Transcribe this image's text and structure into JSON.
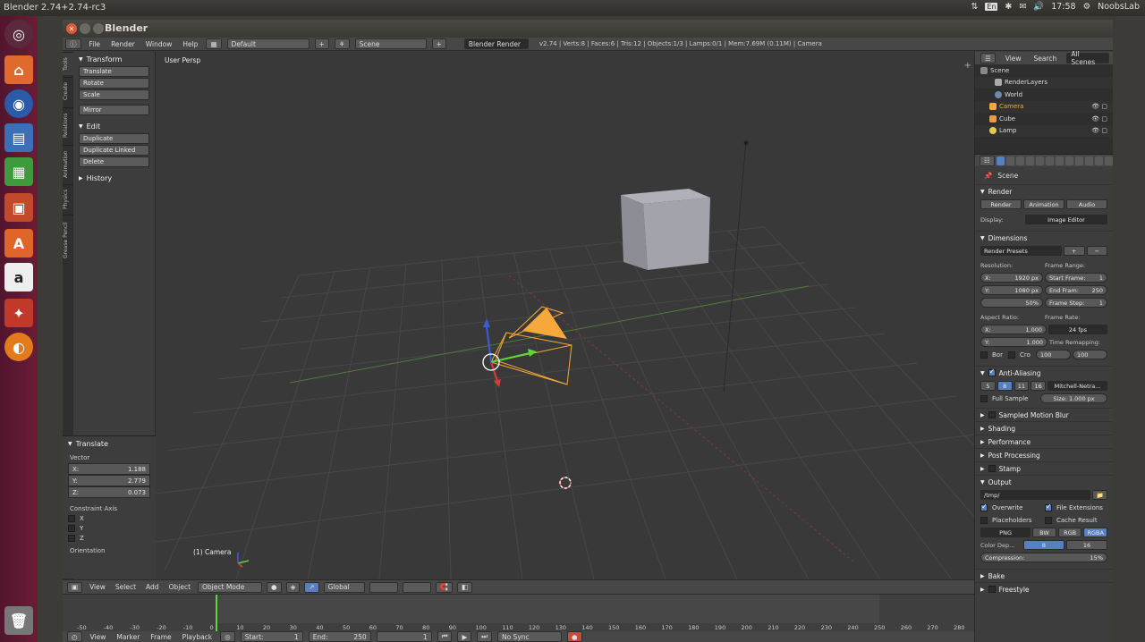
{
  "os": {
    "title": "Blender 2.74+2.74-rc3",
    "lang": "En",
    "time": "17:58",
    "user": "NoobsLab"
  },
  "window": {
    "title": "Blender"
  },
  "info": {
    "menus": [
      "File",
      "Render",
      "Window",
      "Help"
    ],
    "layout": "Default",
    "scene": "Scene",
    "engine": "Blender Render",
    "stats": "v2.74 | Verts:8 | Faces:6 | Tris:12 | Objects:1/3 | Lamps:0/1 | Mem:7.69M (0.11M) | Camera"
  },
  "tool_tabs": [
    "Tools",
    "Create",
    "Relations",
    "Animation",
    "Physics",
    "Grease Pencil"
  ],
  "toolshelf": {
    "transform_header": "Transform",
    "transform_buttons": [
      "Translate",
      "Rotate",
      "Scale"
    ],
    "mirror": "Mirror",
    "edit_header": "Edit",
    "edit_buttons": [
      "Duplicate",
      "Duplicate Linked",
      "Delete"
    ],
    "history": "History"
  },
  "operator": {
    "header": "Translate",
    "vector_label": "Vector",
    "x_label": "X:",
    "x": "1.188",
    "y_label": "Y:",
    "y": "2.779",
    "z_label": "Z:",
    "z": "0.073",
    "constraint_label": "Constraint Axis",
    "axes": [
      "X",
      "Y",
      "Z"
    ],
    "orientation": "Orientation"
  },
  "viewport": {
    "view_name": "User Persp",
    "object_name": "(1) Camera"
  },
  "view3d_header": {
    "menus": [
      "View",
      "Select",
      "Add",
      "Object"
    ],
    "mode": "Object Mode",
    "orientation": "Global"
  },
  "timeline": {
    "ticks": [
      "-50",
      "-40",
      "-30",
      "-20",
      "-10",
      "0",
      "10",
      "20",
      "30",
      "40",
      "50",
      "60",
      "70",
      "80",
      "90",
      "100",
      "110",
      "120",
      "130",
      "140",
      "150",
      "160",
      "170",
      "180",
      "190",
      "200",
      "210",
      "220",
      "230",
      "240",
      "250",
      "260",
      "270",
      "280"
    ],
    "current_frame": 0
  },
  "timeline_header": {
    "menus": [
      "View",
      "Marker",
      "Frame",
      "Playback"
    ],
    "start_label": "Start:",
    "start": "1",
    "end_label": "End:",
    "end": "250",
    "frame": "1",
    "sync": "No Sync"
  },
  "outliner": {
    "menus": [
      "View",
      "Search"
    ],
    "filter": "All Scenes",
    "items": [
      "Scene",
      "RenderLayers",
      "World",
      "Camera",
      "Cube",
      "Lamp"
    ]
  },
  "properties": {
    "context": "Scene",
    "render_header": "Render",
    "render_buttons": [
      "Render",
      "Animation",
      "Audio"
    ],
    "display_label": "Display:",
    "display": "Image Editor",
    "dimensions_header": "Dimensions",
    "presets": "Render Presets",
    "resolution_label": "Resolution:",
    "res_x_label": "X:",
    "res_x": "1920 px",
    "res_y_label": "Y:",
    "res_y": "1080 px",
    "res_pct": "50%",
    "frame_range_label": "Frame Range:",
    "start_label": "Start Frame:",
    "start_frame": "1",
    "end_label": "End Fram:",
    "end_frame": "250",
    "step_label": "Frame Step:",
    "step": "1",
    "aspect_label": "Aspect Ratio:",
    "asp_x_label": "X:",
    "asp_x": "1.000",
    "asp_y_label": "Y:",
    "asp_y": "1.000",
    "frame_rate_label": "Frame Rate:",
    "frame_rate": "24 fps",
    "bor": "Bor",
    "cro": "Cro",
    "remap_label": "Time Remapping:",
    "remap_old": "100",
    "remap_new": "100",
    "aa_header": "Anti-Aliasing",
    "aa_samples": [
      "5",
      "8",
      "11",
      "16"
    ],
    "aa_filter": "Mitchell-Netra...",
    "full_sample": "Full Sample",
    "aa_size": "Size: 1.000 px",
    "collapsed": [
      "Sampled Motion Blur",
      "Shading",
      "Performance",
      "Post Processing",
      "Stamp"
    ],
    "output_header": "Output",
    "output_path": "/tmp/",
    "overwrite": "Overwrite",
    "file_ext": "File Extensions",
    "placeholders": "Placeholders",
    "cache": "Cache Result",
    "format": "PNG",
    "color_modes": [
      "BW",
      "RGB",
      "RGBA"
    ],
    "color_depth_label": "Color Dep...",
    "depths": [
      "8",
      "16"
    ],
    "compression": "Compression:",
    "compression_val": "15%",
    "bake": "Bake",
    "freestyle": "Freestyle"
  },
  "colors": {
    "accent_blue": "#5680c2",
    "selection_orange": "#f7a83a",
    "launcher": "#5e1a34"
  }
}
